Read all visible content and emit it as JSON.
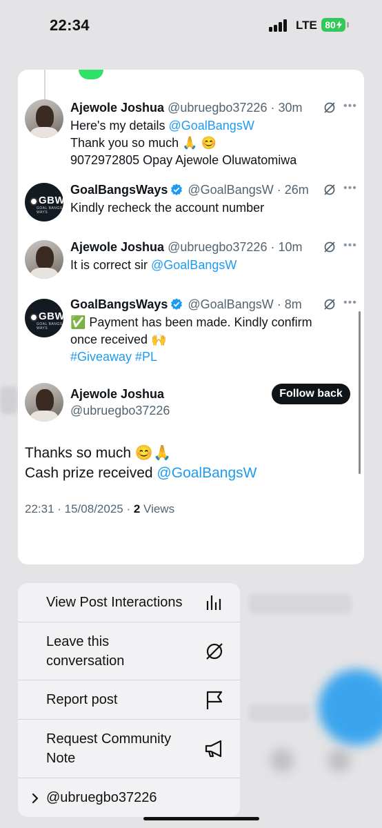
{
  "status_bar": {
    "time": "22:34",
    "network": "LTE",
    "battery": "80"
  },
  "tweets": [
    {
      "name": "Ajewole Joshua",
      "handle": "@ubruegbo37226 · 30m",
      "lines": [
        "Here's my details ",
        "Thank you so much 🙏 😊",
        "9072972805 Opay Ajewole Oluwatomiwa"
      ],
      "mention": "@GoalBangsW"
    },
    {
      "name": "GoalBangsWays",
      "handle": "@GoalBangsW · 26m",
      "lines": [
        "Kindly recheck the account number"
      ]
    },
    {
      "name": "Ajewole Joshua",
      "handle": "@ubruegbo37226 · 10m",
      "lines": [
        "It is correct sir "
      ],
      "mention": "@GoalBangsW"
    },
    {
      "name": "GoalBangsWays",
      "handle": "@GoalBangsW · 8m",
      "lines": [
        "✅ Payment has been made. Kindly confirm",
        "once received 🙌"
      ],
      "hashtags": "#Giveaway #PL"
    }
  ],
  "avatar_brand": {
    "text": "GBW",
    "subtext": "GOAL BANGS WAYS"
  },
  "main_post": {
    "name": "Ajewole Joshua",
    "handle": "@ubruegbo37226",
    "follow_label": "Follow back",
    "line1": "Thanks so much 😊🙏",
    "line2": "Cash prize received ",
    "mention": "@GoalBangsW",
    "timestamp": "22:31 · 15/08/2025 · ",
    "views_count": "2",
    "views_label": " Views"
  },
  "menu": {
    "items": [
      {
        "label": "View Post Interactions",
        "icon": "bar-chart-icon"
      },
      {
        "label": "Leave this conversation",
        "icon": "mute-conversation-icon"
      },
      {
        "label": "Report post",
        "icon": "flag-icon"
      },
      {
        "label": "Request Community Note",
        "icon": "megaphone-icon"
      },
      {
        "label": "@ubruegbo37226",
        "icon": "chevron-right-icon"
      }
    ]
  },
  "colors": {
    "link": "#1d9bf0",
    "battery": "#34c759",
    "text": "#0f1419",
    "muted": "#536471"
  }
}
